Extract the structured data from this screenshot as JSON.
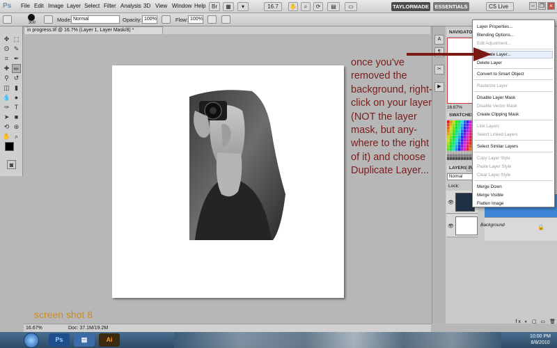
{
  "app": {
    "logo": "Ps",
    "menu": [
      "File",
      "Edit",
      "Image",
      "Layer",
      "Select",
      "Filter",
      "Analysis",
      "3D",
      "View",
      "Window",
      "Help"
    ],
    "zoom_control": "16.7",
    "workspaces": [
      "TAYLORMADE",
      "ESSENTIALS"
    ],
    "cs_live": "CS Live"
  },
  "options_bar": {
    "brush_size": "300",
    "mode_label": "Mode:",
    "mode_value": "Normal",
    "opacity_label": "Opacity:",
    "opacity_value": "100%",
    "flow_label": "Flow:",
    "flow_value": "100%"
  },
  "document": {
    "tab_title": "in progress.tif @ 16.7% (Layer 1, Layer Mask/8) *",
    "status_zoom": "16.67%",
    "status_doc": "Doc: 37.1M/19.2M"
  },
  "annotation": {
    "text": "once you've removed the background, right-click on your layer (NOT the layer mask, but any-where to the right of it) and choose Duplicate Layer...",
    "screen_shot_label": "screen shot 8"
  },
  "panels": {
    "navigator_tab": "NAVIGATOR",
    "navigator_zoom": "16.67%",
    "swatches_tab": "SWATCHES",
    "layers_tab": "LAYERS",
    "layers_tab2": "PA",
    "blend_mode": "Normal",
    "lock_label": "Lock:",
    "layers": [
      {
        "name": "",
        "selected": true
      },
      {
        "name": "Background",
        "selected": false
      }
    ]
  },
  "context_menu": {
    "items": [
      {
        "label": "Layer Properties...",
        "disabled": false
      },
      {
        "label": "Blending Options...",
        "disabled": false
      },
      {
        "label": "Edit Adjustment...",
        "disabled": true
      },
      {
        "label": "Duplicate Layer...",
        "disabled": false,
        "highlight": true
      },
      {
        "label": "Delete Layer",
        "disabled": false
      },
      {
        "label": "Convert to Smart Object",
        "disabled": false
      },
      {
        "label": "Rasterize Layer",
        "disabled": true
      },
      {
        "label": "Disable Layer Mask",
        "disabled": false
      },
      {
        "label": "Disable Vector Mask",
        "disabled": true
      },
      {
        "label": "Create Clipping Mask",
        "disabled": false
      },
      {
        "label": "Link Layers",
        "disabled": true
      },
      {
        "label": "Select Linked Layers",
        "disabled": true
      },
      {
        "label": "Select Similar Layers",
        "disabled": false
      },
      {
        "label": "Copy Layer Style",
        "disabled": true
      },
      {
        "label": "Paste Layer Style",
        "disabled": true
      },
      {
        "label": "Clear Layer Style",
        "disabled": true
      },
      {
        "label": "Merge Down",
        "disabled": false
      },
      {
        "label": "Merge Visible",
        "disabled": false
      },
      {
        "label": "Flatten Image",
        "disabled": false
      }
    ]
  },
  "taskbar": {
    "time": "10:00 PM",
    "date": "8/8/2010"
  },
  "colors": {
    "annotation": "#7a1d1d",
    "arrow": "#7a1a12",
    "screen_shot_label": "#d08b1e",
    "layer_selected": "#3d86d6",
    "taskbar": "#2d4b66"
  }
}
